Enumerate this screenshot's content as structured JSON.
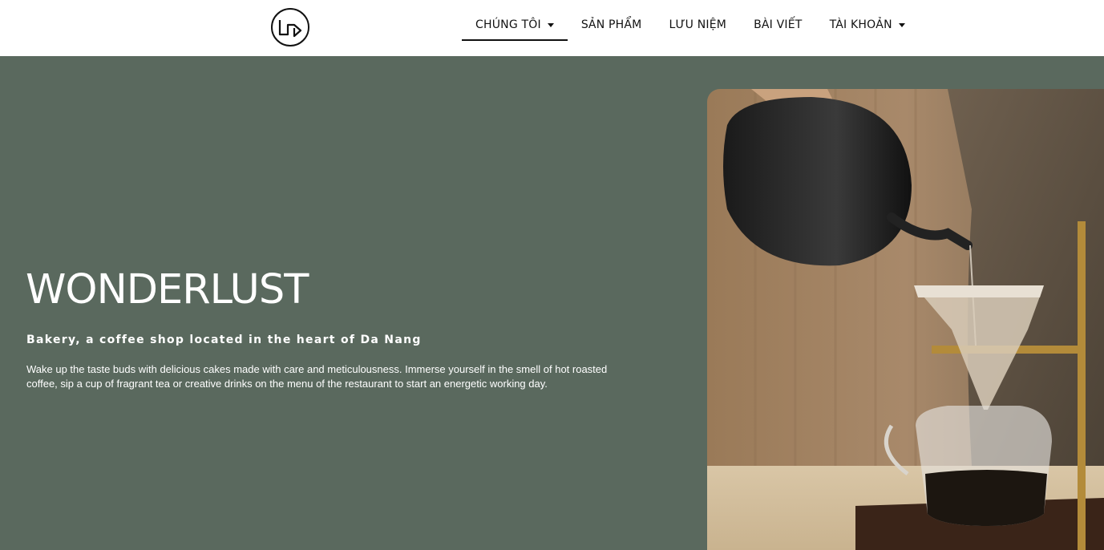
{
  "brand": {
    "logo_icon": "wl-monogram-logo"
  },
  "nav": {
    "items": [
      {
        "label": "CHÚNG TÔI",
        "has_dropdown": true,
        "active": true
      },
      {
        "label": "SẢN PHẨM",
        "has_dropdown": false
      },
      {
        "label": "LƯU NIỆM",
        "has_dropdown": false
      },
      {
        "label": "BÀI VIẾT",
        "has_dropdown": false
      },
      {
        "label": "TÀI KHOẢN",
        "has_dropdown": true
      }
    ]
  },
  "hero": {
    "title": "WONDERLUST",
    "subtitle": "Bakery, a coffee shop located in the heart of Da Nang",
    "description": "Wake up the taste buds with delicious cakes made with care and meticulousness. Immerse yourself in the smell of hot roasted coffee, sip a cup of fragrant tea or creative drinks on the menu of the restaurant to start an energetic working day.",
    "background_color": "#5a695e",
    "image_subject": "pour-over-coffee-photo"
  }
}
